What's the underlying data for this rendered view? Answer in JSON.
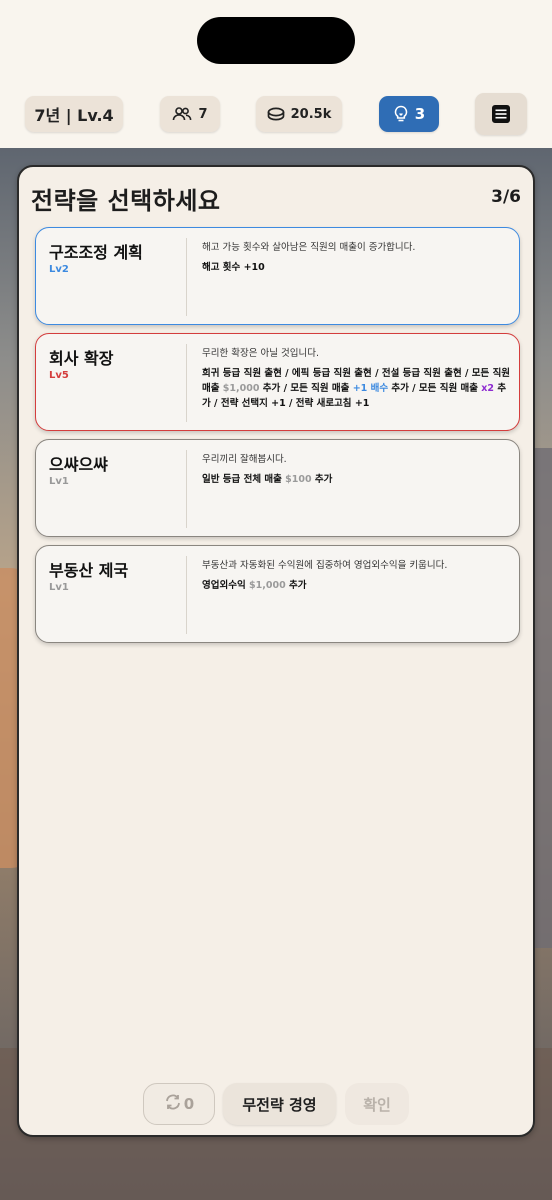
{
  "hud": {
    "level": "7년 | Lv.4",
    "staff_count": "7",
    "money": "20.5k",
    "ideas": "3"
  },
  "modal": {
    "title": "전략을 선택하세요",
    "counter": "3/6"
  },
  "cards": [
    {
      "name": "구조조정 계획",
      "level": "Lv2",
      "desc": "해고 가능 횟수와 살아남은 직원의 매출이 증가합니다.",
      "effect": "해고 횟수 +10"
    },
    {
      "name": "회사 확장",
      "level": "Lv5",
      "desc": "무리한 확장은 아닐 것입니다.",
      "effect_parts": [
        "희귀 등급 직원 출현 / 에픽 등급 직원 출현 / 전설 등급 직원 출현 / 모든 직원 매출 ",
        "$1,000",
        " 추가 / 모든 직원 매출 ",
        "+1 배수",
        " 추가 / 모든 직원 매출 ",
        "x2",
        " 추가 / 전략 선택지 +1 / 전략 새로고침 +1"
      ]
    },
    {
      "name": "으쌰으쌰",
      "level": "Lv1",
      "desc": "우리끼리 잘해봅시다.",
      "effect_parts": [
        "일반 등급 전체 매출 ",
        "$100",
        " 추가"
      ]
    },
    {
      "name": "부동산 제국",
      "level": "Lv1",
      "desc": "부동산과 자동화된 수익원에 집중하여 영업외수익을 키웁니다.",
      "effect_parts": [
        "영업외수익 ",
        "$1,000",
        " 추가"
      ]
    }
  ],
  "buttons": {
    "refresh_count": "0",
    "no_strategy": "무전략 경영",
    "confirm": "확인"
  },
  "colors": {
    "rare_blue": "#3d8ae0",
    "legend_red": "#d43d3d",
    "multiplier_purple": "#8e2bd0",
    "idea_pill": "#2f6db5"
  }
}
